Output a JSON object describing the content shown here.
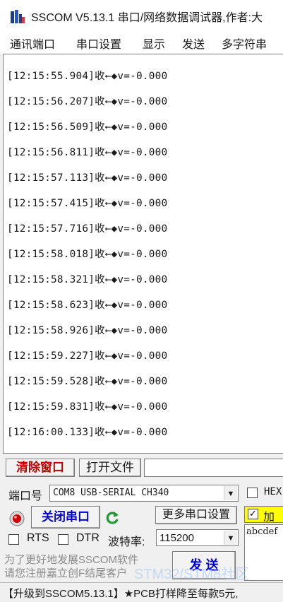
{
  "window": {
    "title": "SSCOM V5.13.1 串口/网络数据调试器,作者:大"
  },
  "menu": [
    "通讯端口",
    "串口设置",
    "显示",
    "发送",
    "多字符串"
  ],
  "receive_lines": [
    "[12:15:55.904]收←◆v=-0.000",
    "[12:15:56.207]收←◆v=-0.000",
    "[12:15:56.509]收←◆v=-0.000",
    "[12:15:56.811]收←◆v=-0.000",
    "[12:15:57.113]收←◆v=-0.000",
    "[12:15:57.415]收←◆v=-0.000",
    "[12:15:57.716]收←◆v=-0.000",
    "[12:15:58.018]收←◆v=-0.000",
    "[12:15:58.321]收←◆v=-0.000",
    "[12:15:58.623]收←◆v=-0.000",
    "[12:15:58.926]收←◆v=-0.000",
    "[12:15:59.227]收←◆v=-0.000",
    "[12:15:59.528]收←◆v=-0.000",
    "[12:15:59.831]收←◆v=-0.000",
    "[12:16:00.133]收←◆v=-0.000"
  ],
  "toolbar": {
    "clear_label": "清除窗口",
    "open_file_label": "打开文件"
  },
  "port": {
    "label": "端口号",
    "value": "COM8 USB-SERIAL CH340",
    "hex_label": "HEX",
    "close_label": "关闭串口",
    "more_settings_label": "更多串口设置",
    "add_time_label": "加",
    "rts_label": "RTS",
    "dtr_label": "DTR",
    "baud_label": "波特率:",
    "baud_value": "115200",
    "send_text": "abcdef"
  },
  "promo": {
    "line1": "为了更好地发展SSCOM软件",
    "line2": "请您注册嘉立创F结尾客户",
    "send_label": "发 送"
  },
  "watermark": "STM32/STM8社区",
  "status_text": "【升级到SSCOM5.13.1】★PCB打样降至每款5元,",
  "colors": {
    "record_icon": "#cc0000",
    "refresh_icon": "#1e9a2f",
    "checked_highlight": "#ffff00",
    "clear_label": "#c00000",
    "close_label": "#0000cc"
  },
  "icons": {
    "app": "sscom-app-icon",
    "record": "record-icon",
    "refresh": "refresh-icon",
    "dropdown": "chevron-down-icon"
  }
}
